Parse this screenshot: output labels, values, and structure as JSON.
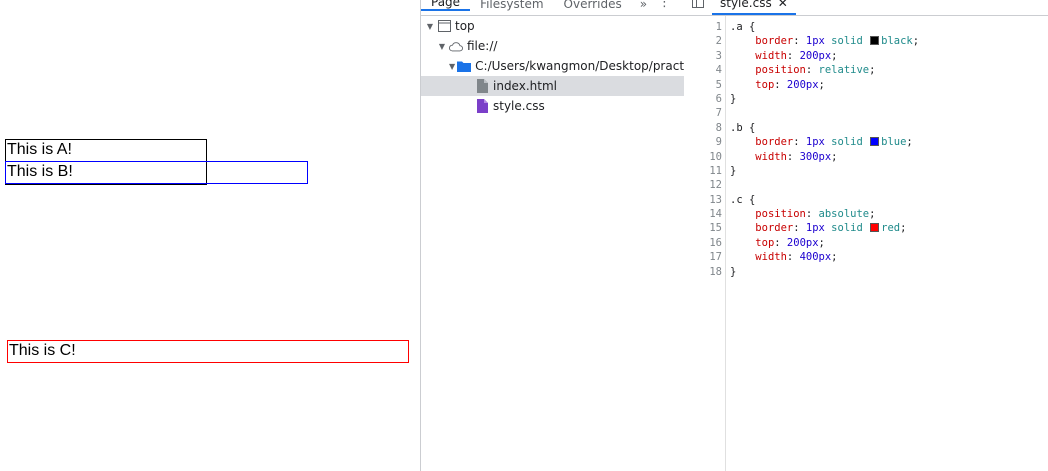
{
  "page": {
    "box_a": "This is A!",
    "box_b": "This is B!",
    "box_c": "This is C!"
  },
  "navigator": {
    "tabs": [
      "Page",
      "Filesystem",
      "Overrides",
      "»"
    ],
    "menu": "⋮",
    "tree": [
      {
        "label": "top",
        "icon": "frame-icon"
      },
      {
        "label": "file://",
        "icon": "cloud-icon"
      },
      {
        "label": "C:/Users/kwangmon/Desktop/practice",
        "icon": "folder-icon"
      },
      {
        "label": "index.html",
        "icon": "html-file-icon"
      },
      {
        "label": "style.css",
        "icon": "css-file-icon"
      }
    ]
  },
  "editor": {
    "file_tab": "style.css",
    "close": "✕",
    "swatch_colors": {
      "black": "#000000",
      "blue": "#0000ff",
      "red": "#ff0000"
    },
    "lines": [
      {
        "n": "1",
        "sel": ".a {"
      },
      {
        "n": "2",
        "prop": "border",
        "v1": "1px",
        "v2": " solid ",
        "sw": "black",
        "v3": "black",
        "end": ";"
      },
      {
        "n": "3",
        "prop": "width",
        "v1": "200px",
        "end": ";"
      },
      {
        "n": "4",
        "prop": "position",
        "kw": "relative",
        "end": ";"
      },
      {
        "n": "5",
        "prop": "top",
        "v1": "200px",
        "end": ";"
      },
      {
        "n": "6",
        "sel": "}"
      },
      {
        "n": "7",
        "sel": ""
      },
      {
        "n": "8",
        "sel": ".b {"
      },
      {
        "n": "9",
        "prop": "border",
        "v1": "1px",
        "v2": " solid ",
        "sw": "blue",
        "v3": "blue",
        "end": ";"
      },
      {
        "n": "10",
        "prop": "width",
        "v1": "300px",
        "end": ";"
      },
      {
        "n": "11",
        "sel": "}"
      },
      {
        "n": "12",
        "sel": ""
      },
      {
        "n": "13",
        "sel": ".c {"
      },
      {
        "n": "14",
        "prop": "position",
        "kw": "absolute",
        "end": ";"
      },
      {
        "n": "15",
        "prop": "border",
        "v1": "1px",
        "v2": " solid ",
        "sw": "red",
        "v3": "red",
        "end": ";"
      },
      {
        "n": "16",
        "prop": "top",
        "v1": "200px",
        "end": ";"
      },
      {
        "n": "17",
        "prop": "width",
        "v1": "400px",
        "end": ";"
      },
      {
        "n": "18",
        "sel": "}"
      }
    ]
  }
}
